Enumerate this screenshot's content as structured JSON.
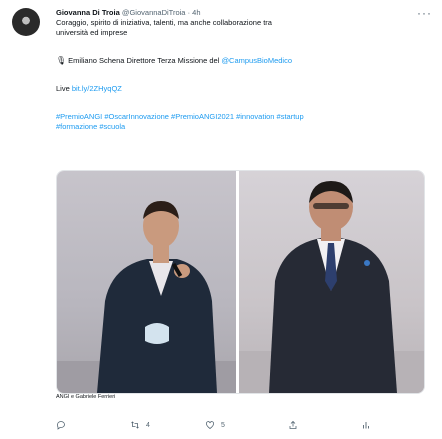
{
  "tweet": {
    "author_name": "Giovanna Di Troia",
    "author_handle": "@GiovannaDiTroia",
    "separator": "·",
    "time": "4h",
    "line1": "Coraggio, spirito di iniziativa, talenti, ma anche  collaborazione tra",
    "line2": "università ed imprese",
    "emiliano_prefix": "Emiliano Schena Direttore Terza Missione del",
    "emiliano_mention": "@CampusBioMedico",
    "live_label": "Live",
    "live_link": "bit.ly/2ZHyqQZ",
    "hashtags_line1": "#PremioANGI #OscarInnovazione #PremioANGI2021 #innovation #startup",
    "hashtags_line2": "#formazione #scuola",
    "media_caption": "ANGI e Gabriele Ferrieri"
  },
  "icons": {
    "more": "more-icon",
    "mic": "microphone-icon",
    "reply": "reply-icon",
    "retweet": "retweet-icon",
    "like": "heart-icon",
    "share": "share-icon",
    "analytics": "analytics-icon"
  },
  "actions": {
    "retweet_count": "4",
    "like_count": "5"
  },
  "colors": {
    "link": "#1d9bf0",
    "muted": "#536471",
    "text": "#0f1419"
  }
}
